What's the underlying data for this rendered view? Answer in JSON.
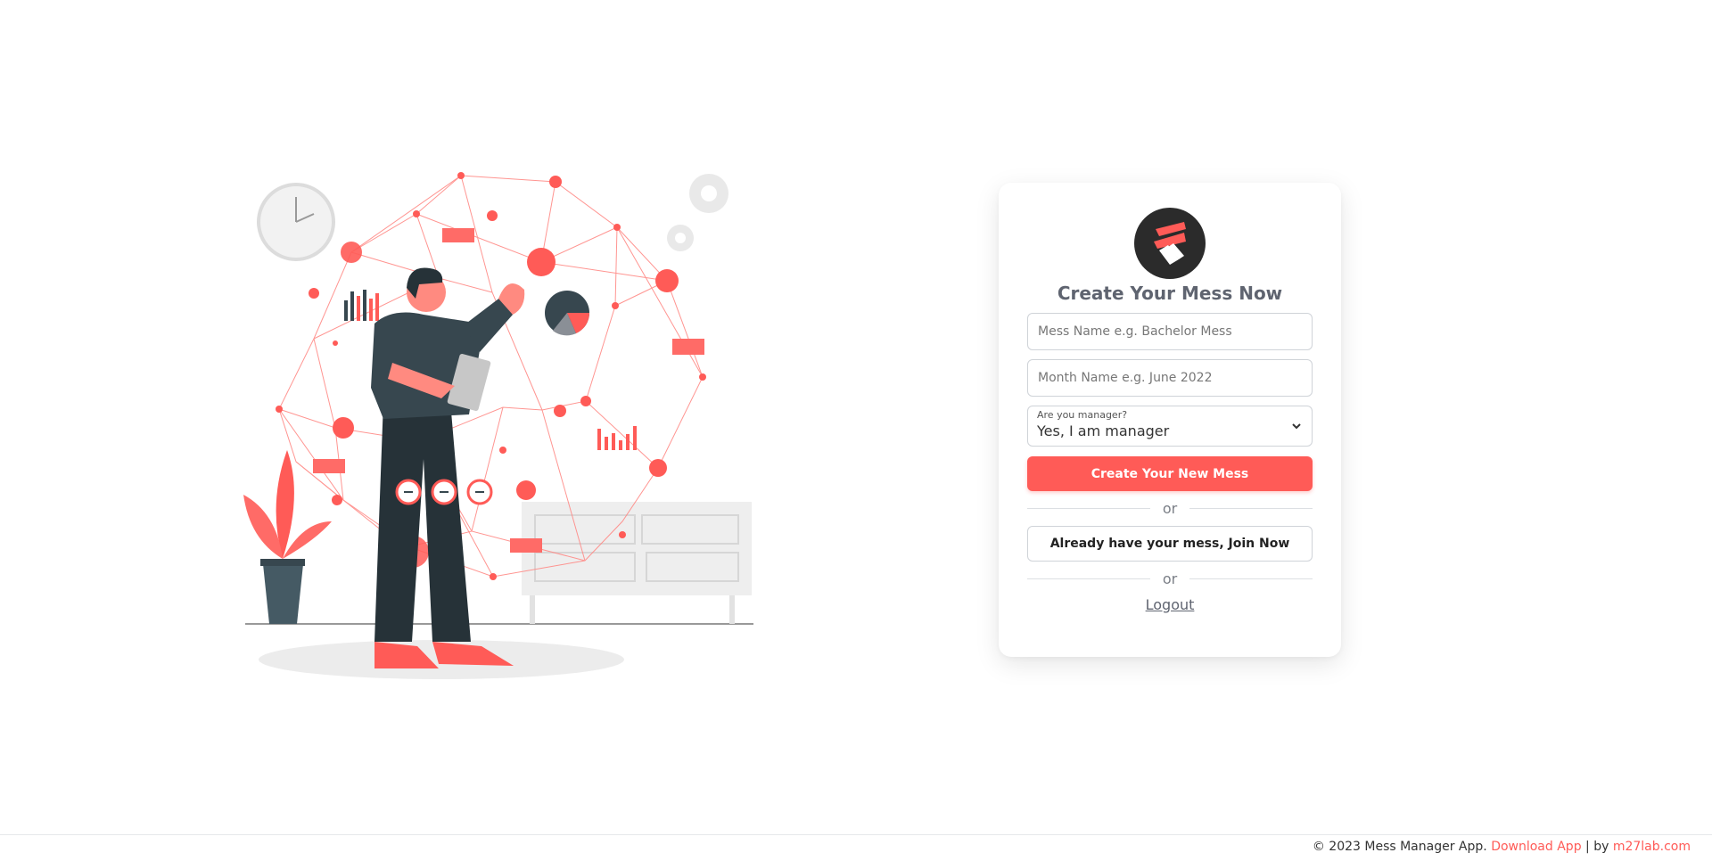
{
  "colors": {
    "accent": "#ff5b57",
    "dark": "#2b2b2b",
    "title": "#5f6470"
  },
  "card": {
    "logo_icon": "mess-manager-logo",
    "title": "Create Your Mess Now",
    "mess_name_placeholder": "Mess Name e.g. Bachelor Mess",
    "month_name_placeholder": "Month Name e.g. June 2022",
    "manager_select": {
      "label": "Are you manager?",
      "selected": "Yes, I am manager"
    },
    "create_button": "Create Your New Mess",
    "or_1": "or",
    "join_button": "Already have your mess, Join Now",
    "or_2": "or",
    "logout": "Logout"
  },
  "footer": {
    "copyright": "© 2023 Mess Manager App.",
    "download_link": "Download App",
    "separator": "| by",
    "author_link": "m27lab.com"
  }
}
